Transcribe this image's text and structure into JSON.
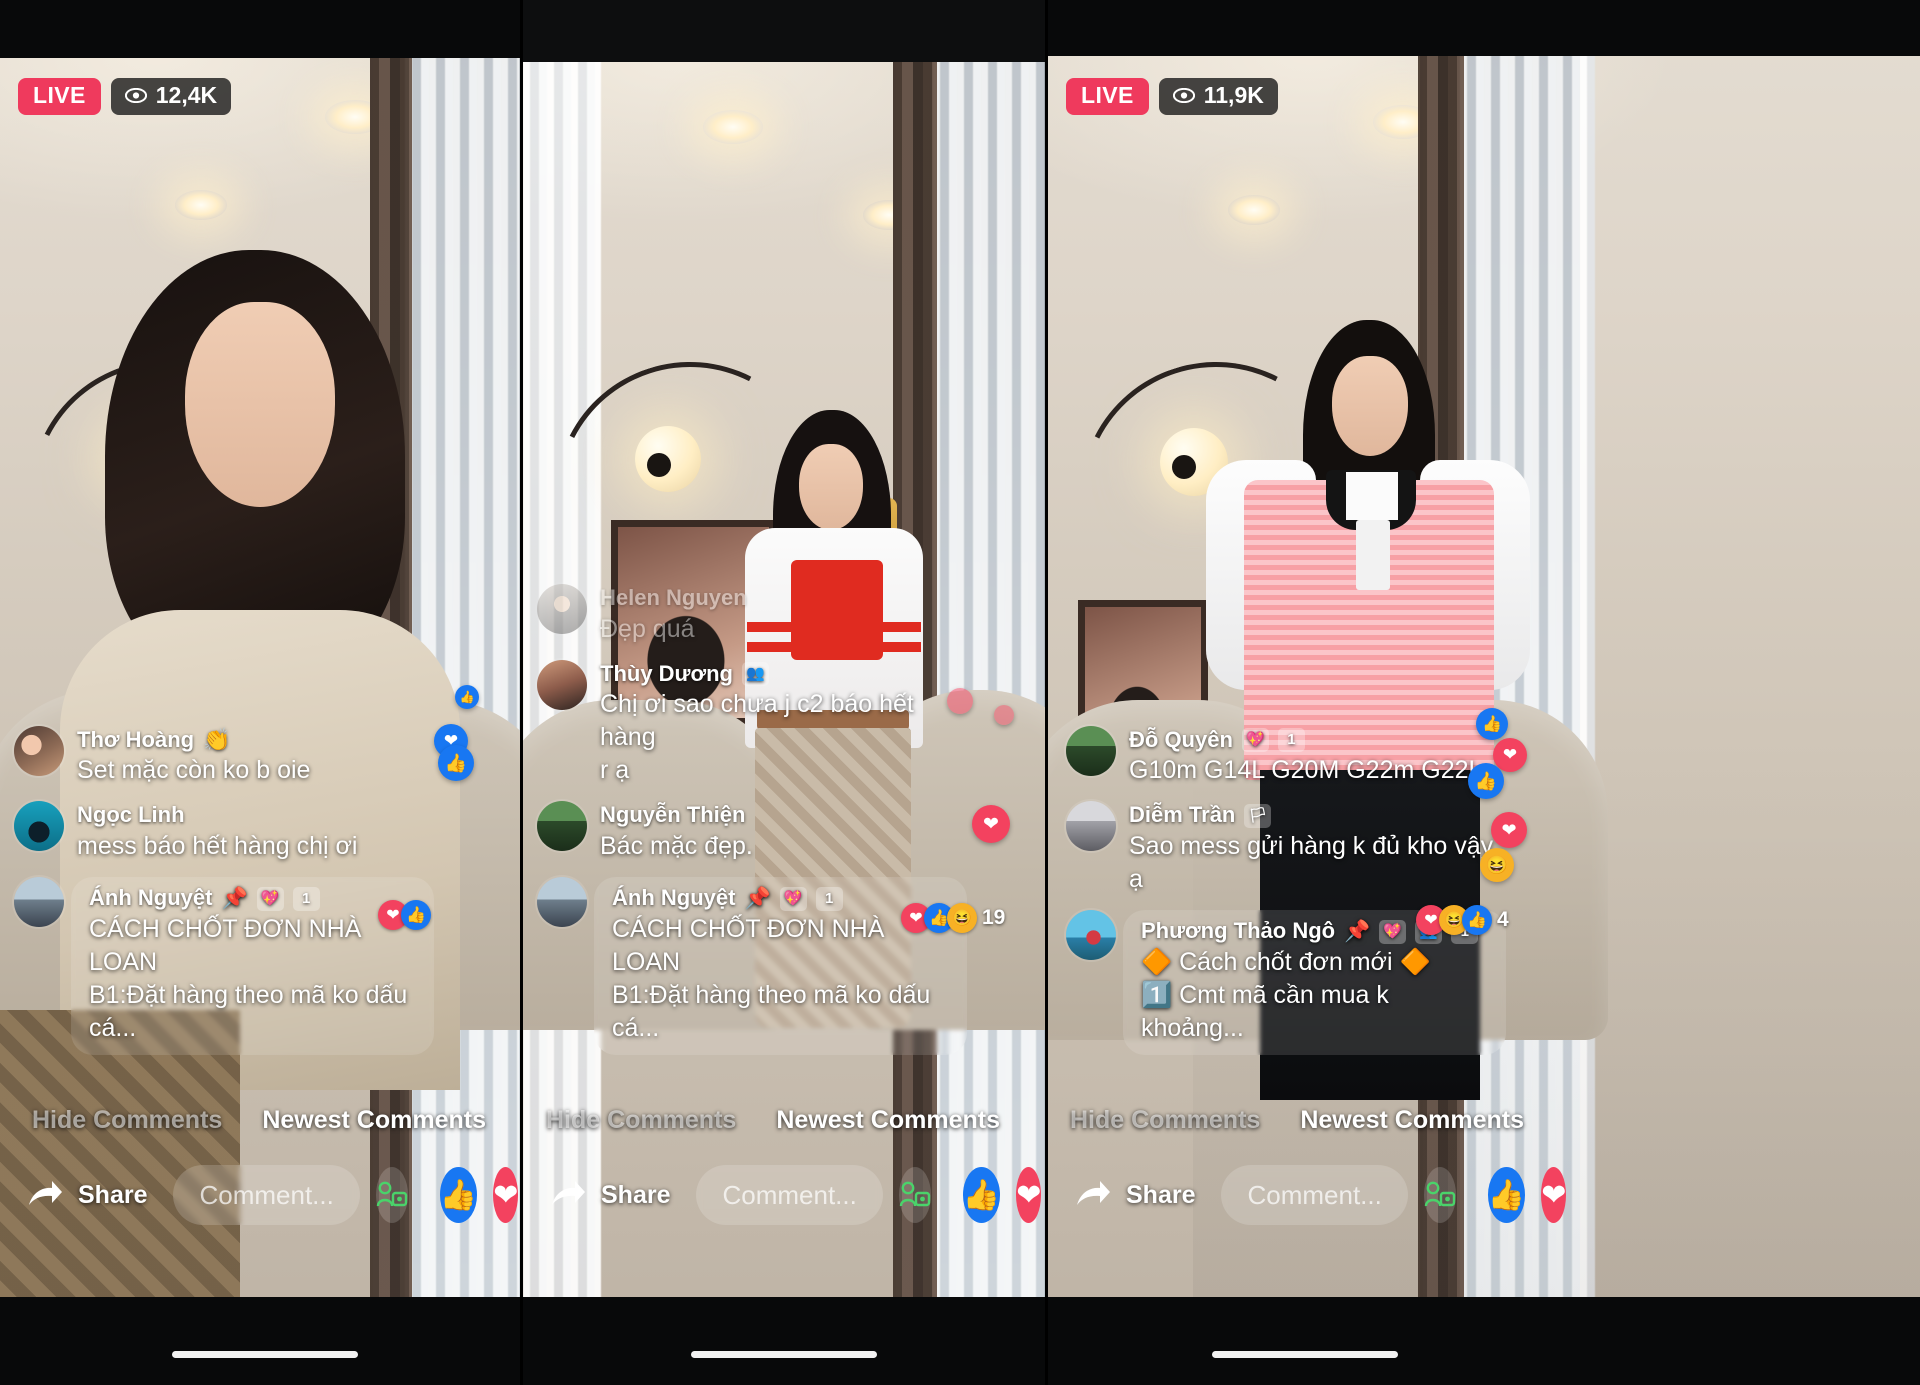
{
  "panels": [
    {
      "id": "panel-1",
      "live": {
        "label": "LIVE",
        "viewers": "12,4K"
      },
      "comments": [
        {
          "name": "Thơ Hoàng",
          "emoji": "👏",
          "text": "Set mặc còn ko b oie",
          "faded": false,
          "badges": []
        },
        {
          "name": "Ngọc Linh",
          "emoji": "",
          "text": "mess báo hết hàng chị ơi",
          "faded": false,
          "badges": []
        },
        {
          "name": "Ánh Nguyệt",
          "emoji": "",
          "text": "CÁCH CHỐT ĐƠN NHÀ LOAN\nB1:Đặt hàng theo mã ko dấu cá...",
          "faded": false,
          "pinned": true,
          "badges": [
            "💖",
            "1"
          ]
        }
      ],
      "reactions": {
        "icons": [
          "love",
          "like"
        ],
        "count": ""
      },
      "controls": {
        "hide": "Hide Comments",
        "newest": "Newest Comments"
      },
      "bottom": {
        "share": "Share",
        "comment_placeholder": "Comment..."
      }
    },
    {
      "id": "panel-2",
      "live": {
        "label": "",
        "viewers": ""
      },
      "comments": [
        {
          "name": "Helen Nguyen",
          "emoji": "",
          "text": "Đẹp quá",
          "faded": true,
          "badges": []
        },
        {
          "name": "Thùy Dương",
          "emoji": "👥",
          "text": "Chị ơi sao chưa j c2 báo hết hàng\nr ạ",
          "faded": false,
          "badges": []
        },
        {
          "name": "Nguyễn Thiện",
          "emoji": "",
          "text": "Bác mặc đẹp.",
          "faded": false,
          "badges": []
        },
        {
          "name": "Ánh Nguyệt",
          "emoji": "",
          "text": "CÁCH CHỐT ĐƠN NHÀ LOAN\nB1:Đặt hàng theo mã ko dấu cá...",
          "faded": false,
          "pinned": true,
          "badges": [
            "💖",
            "1"
          ]
        }
      ],
      "reactions": {
        "icons": [
          "love",
          "like",
          "haha"
        ],
        "count": "19"
      },
      "controls": {
        "hide": "Hide Comments",
        "newest": "Newest Comments"
      },
      "bottom": {
        "share": "Share",
        "comment_placeholder": "Comment..."
      }
    },
    {
      "id": "panel-3",
      "live": {
        "label": "LIVE",
        "viewers": "11,9K"
      },
      "comments": [
        {
          "name": "Đỗ Quyên",
          "emoji": "",
          "text": "G10m G14L G20M G22m G22L",
          "faded": false,
          "badges": [
            "💖",
            "1"
          ]
        },
        {
          "name": "Diễm Trần",
          "emoji": "🏳",
          "text": "Sao mess gửi hàng k đủ kho vậy\nạ",
          "faded": false,
          "badges": []
        },
        {
          "name": "Phương Thảo Ngô",
          "emoji": "",
          "text": "🔶 Cách chốt đơn mới 🔶\n1️⃣ Cmt mã cần mua k khoảng...",
          "faded": false,
          "pinned": true,
          "badges": [
            "💖",
            "👥",
            "1"
          ]
        }
      ],
      "reactions": {
        "icons": [
          "love",
          "haha",
          "like"
        ],
        "count": "4"
      },
      "controls": {
        "hide": "Hide Comments",
        "newest": "Newest Comments"
      },
      "bottom": {
        "share": "Share",
        "comment_placeholder": "Comment..."
      }
    }
  ],
  "colors": {
    "live_red": "#ef3a5d",
    "fb_blue": "#1877f2",
    "love_red": "#f3425f",
    "haha_yellow": "#f7b125",
    "comment_text": "#ffffff"
  },
  "icons": {
    "eye": "eye-icon",
    "share": "share-arrow-icon",
    "viewer": "viewer-silhouette-icon",
    "like": "thumbs-up-icon",
    "love": "heart-icon",
    "haha": "laughing-face-icon",
    "pin": "pin-icon"
  }
}
